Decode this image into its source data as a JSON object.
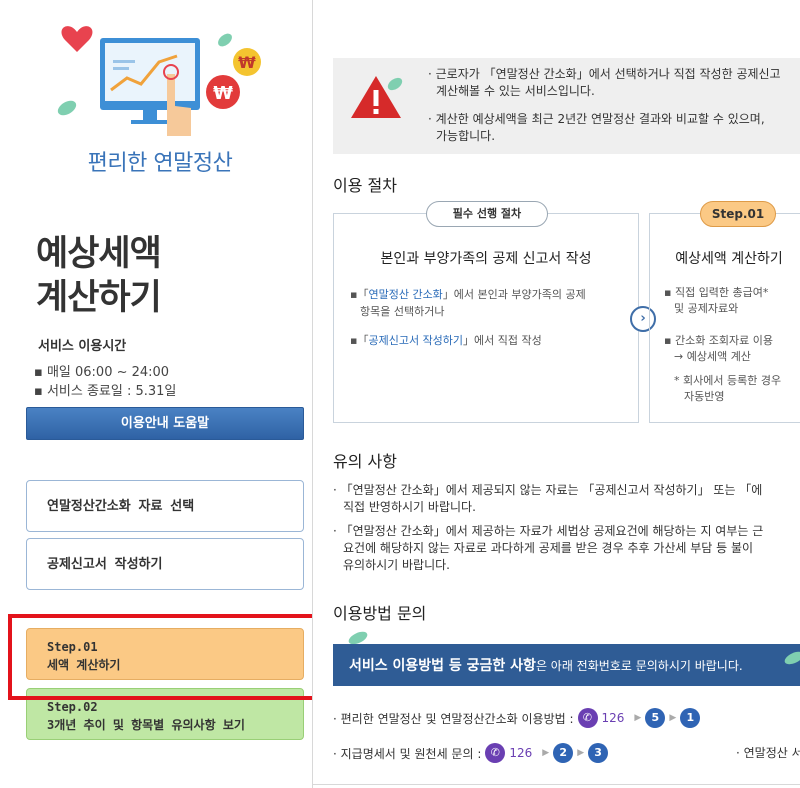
{
  "sidebar": {
    "logo_title": "편리한 연말정산",
    "main_title_line1": "예상세액",
    "main_title_line2": "계산하기",
    "hours_heading": "서비스 이용시간",
    "hours_1": "▪ 매일 06:00 ~ 24:00",
    "hours_2": "▪ 서비스 종료일 : 5.31일",
    "help_button": "이용안내 도움말",
    "menu_1": "연말정산간소화 자료 선택",
    "menu_2": "공제신고서 작성하기",
    "step1_label": "Step.01",
    "step1_title": "세액 계산하기",
    "step2_label": "Step.02",
    "step2_title": "3개년 추이 및 항목별 유의사항 보기"
  },
  "notice": {
    "line1a": "· 근로자가 「연말정산 간소화」에서 선택하거나 직접 작성한 공제신고",
    "line1b": "계산해볼 수 있는 서비스입니다.",
    "line2a": "· 계산한 예상세액을 최근 2년간 연말정산 결과와 비교할 수 있으며,",
    "line2b": "가능합니다."
  },
  "procedure": {
    "title": "이용 절차",
    "card1": {
      "pill": "필수 선행 절차",
      "title": "본인과 부양가족의 공제 신고서 작성",
      "l1_pre": "▪「",
      "l1_quote": "연말정산 간소화",
      "l1_post": "」에서 본인과 부양가족의 공제",
      "l2": "항목을 선택하거나",
      "l3_pre": "▪「",
      "l3_quote": "공제신고서 작성하기",
      "l3_post": "」에서 직접 작성"
    },
    "card2": {
      "pill": "Step.01",
      "title": "예상세액 계산하기",
      "l1": "▪ 직접 입력한 총급여*",
      "l2": "및 공제자료와",
      "l3": "▪ 간소화 조회자료 이용",
      "l4": "→ 예상세액 계산",
      "l5": "* 회사에서 등록한 경우",
      "l6": "자동반영"
    },
    "arrow": "›"
  },
  "cautions": {
    "title": "유의 사항",
    "c1a": "· 「연말정산 간소화」에서 제공되지 않는 자료는 「공제신고서 작성하기」 또는 「에",
    "c1b": "직접 반영하시기 바랍니다.",
    "c2a": "· 「연말정산 간소화」에서 제공하는 자료가 세법상 공제요건에 해당하는 지 여부는 근",
    "c2b": "요건에 해당하지 않는 자료로 과다하게 공제를 받은 경우 추후 가산세 부담 등 불이",
    "c2c": "유의하시기 바랍니다."
  },
  "inquiry": {
    "title": "이용방법 문의",
    "banner_strong": "서비스 이용방법 등 궁금한 사항",
    "banner_rest": "은 아래 전화번호로 문의하시기 바랍니다.",
    "line1_label": "· 편리한 연말정산 및 연말정산간소화 이용방법 :",
    "line1_tel": "126",
    "line1_n1": "5",
    "line1_n2": "1",
    "line2_label": "· 지급명세서 및 원천세 문의 :",
    "line2_tel": "126",
    "line2_n1": "2",
    "line2_n2": "3",
    "line3_label": "· 연말정산 서"
  },
  "colors": {
    "accent_blue": "#2f5c95",
    "step1_bg": "#fbc985",
    "step2_bg": "#bfe7a4",
    "highlight_red": "#e3131b"
  }
}
